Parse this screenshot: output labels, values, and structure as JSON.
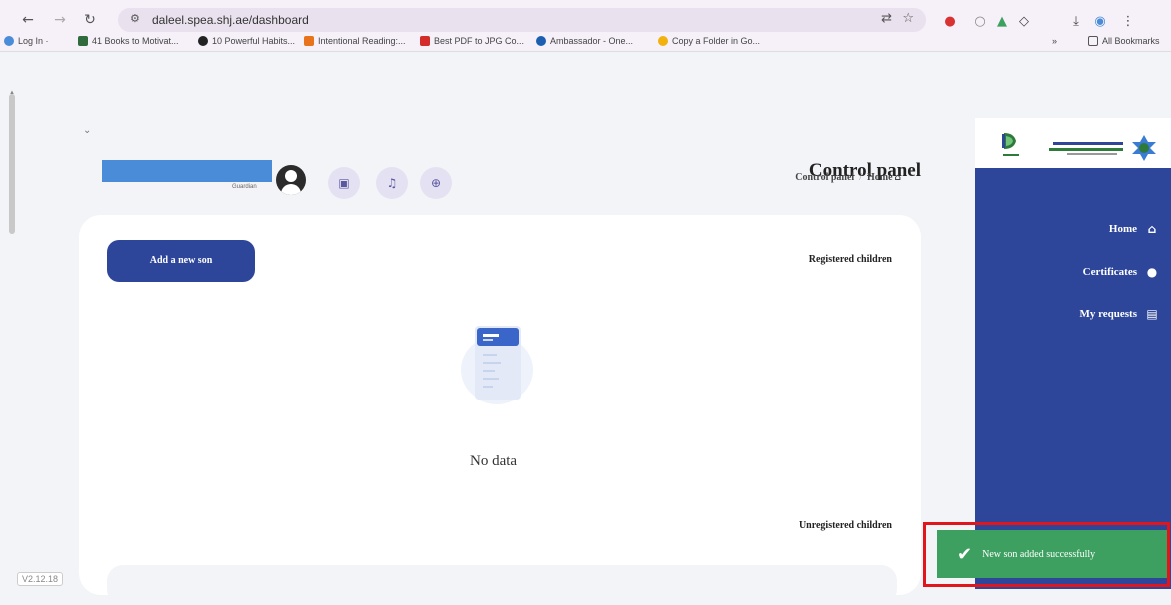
{
  "browser": {
    "url": "daleel.spea.shj.ae/dashboard",
    "nav_icons": [
      "back-arrow-icon",
      "forward-arrow-icon",
      "reload-icon"
    ],
    "bookmarks": [
      {
        "label": "Log In ·",
        "color": "#4a8cd8"
      },
      {
        "label": "41 Books to Motivat...",
        "color": "#2f6b3c"
      },
      {
        "label": "10 Powerful Habits...",
        "color": "#222222"
      },
      {
        "label": "Intentional Reading:...",
        "color": "#e8731a"
      },
      {
        "label": "Best PDF to JPG Co...",
        "color": "#d42b2b"
      },
      {
        "label": "Ambassador - One...",
        "color": "#1c5fb0"
      },
      {
        "label": "Copy a Folder in Go...",
        "color": "#f2b10c"
      }
    ],
    "bookmarks_more": "»",
    "all_bookmarks": "All Bookmarks"
  },
  "header": {
    "title": "Control panel",
    "breadcrumb": [
      "Control panel",
      "Home"
    ],
    "user_role": "Guardian"
  },
  "main": {
    "add_button": "Add a new son",
    "registered_title": "Registered children",
    "empty_text": "No data",
    "unregistered_title": "Unregistered children"
  },
  "sidebar": {
    "items": [
      {
        "label": "Home",
        "icon": "home-icon"
      },
      {
        "label": "Certificates",
        "icon": "circle-icon"
      },
      {
        "label": "My requests",
        "icon": "requests-icon"
      }
    ]
  },
  "toast": {
    "message": "New son added successfully"
  },
  "version": "V2.12.18",
  "colors": {
    "primary": "#2e469a",
    "success": "#3da061",
    "highlight": "#e0161c"
  }
}
